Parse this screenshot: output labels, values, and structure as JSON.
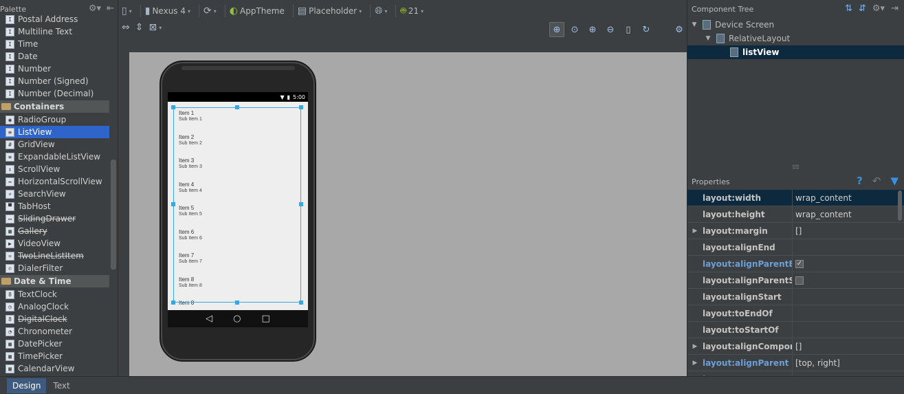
{
  "palette": {
    "title": "Palette",
    "items_top": [
      {
        "label": "Postal Address",
        "icon": "I",
        "strike": false
      },
      {
        "label": "Multiline Text",
        "icon": "I",
        "strike": false
      },
      {
        "label": "Time",
        "icon": "I",
        "strike": false
      },
      {
        "label": "Date",
        "icon": "I",
        "strike": false
      },
      {
        "label": "Number",
        "icon": "I",
        "strike": false
      },
      {
        "label": "Number (Signed)",
        "icon": "I",
        "strike": false
      },
      {
        "label": "Number (Decimal)",
        "icon": "I",
        "strike": false
      }
    ],
    "category_containers": "Containers",
    "containers": [
      {
        "label": "RadioGroup",
        "icon": "◉",
        "strike": false
      },
      {
        "label": "ListView",
        "icon": "≡",
        "strike": false,
        "selected": true
      },
      {
        "label": "GridView",
        "icon": "#",
        "strike": false
      },
      {
        "label": "ExpandableListView",
        "icon": "≡",
        "strike": false
      },
      {
        "label": "ScrollView",
        "icon": "↕",
        "strike": false
      },
      {
        "label": "HorizontalScrollView",
        "icon": "↔",
        "strike": false
      },
      {
        "label": "SearchView",
        "icon": "⌕",
        "strike": false
      },
      {
        "label": "TabHost",
        "icon": "▀",
        "strike": false
      },
      {
        "label": "SlidingDrawer",
        "icon": "▭",
        "strike": true
      },
      {
        "label": "Gallery",
        "icon": "▦",
        "strike": true
      },
      {
        "label": "VideoView",
        "icon": "▶",
        "strike": false
      },
      {
        "label": "TwoLineListItem",
        "icon": "=",
        "strike": true
      },
      {
        "label": "DialerFilter",
        "icon": "✆",
        "strike": false
      }
    ],
    "category_datetime": "Date & Time",
    "datetime": [
      {
        "label": "TextClock",
        "icon": "8",
        "strike": false
      },
      {
        "label": "AnalogClock",
        "icon": "◷",
        "strike": false
      },
      {
        "label": "DigitalClock",
        "icon": "8",
        "strike": true
      },
      {
        "label": "Chronometer",
        "icon": "◔",
        "strike": false
      },
      {
        "label": "DatePicker",
        "icon": "▦",
        "strike": false
      },
      {
        "label": "TimePicker",
        "icon": "▦",
        "strike": false
      },
      {
        "label": "CalendarView",
        "icon": "▦",
        "strike": false
      }
    ]
  },
  "toolbar": {
    "device": "Nexus 4",
    "theme": "AppTheme",
    "activity": "Placeholder",
    "api": "21"
  },
  "device_screen": {
    "time": "5:00",
    "list_items": [
      {
        "title": "Item 1",
        "sub": "Sub Item 1"
      },
      {
        "title": "Item 2",
        "sub": "Sub Item 2"
      },
      {
        "title": "Item 3",
        "sub": "Sub Item 3"
      },
      {
        "title": "Item 4",
        "sub": "Sub Item 4"
      },
      {
        "title": "Item 5",
        "sub": "Sub Item 5"
      },
      {
        "title": "Item 6",
        "sub": "Sub Item 6"
      },
      {
        "title": "Item 7",
        "sub": "Sub Item 7"
      },
      {
        "title": "Item 8",
        "sub": "Sub Item 8"
      },
      {
        "title": "Item 8",
        "sub": ""
      }
    ]
  },
  "component_tree": {
    "title": "Component Tree",
    "nodes": [
      {
        "label": "Device Screen",
        "level": 0
      },
      {
        "label": "RelativeLayout",
        "level": 1
      },
      {
        "label": "listView",
        "level": 2,
        "selected": true
      }
    ]
  },
  "properties": {
    "title": "Properties",
    "rows": [
      {
        "name": "layout:width",
        "value": "wrap_content",
        "expandable": false,
        "blue": false,
        "selected": true
      },
      {
        "name": "layout:height",
        "value": "wrap_content",
        "expandable": false,
        "blue": false
      },
      {
        "name": "layout:margin",
        "value": "[]",
        "expandable": true,
        "blue": false
      },
      {
        "name": "layout:alignEnd",
        "value": "",
        "expandable": false,
        "blue": false
      },
      {
        "name": "layout:alignParentEnd",
        "value": "",
        "checkbox": "checked",
        "expandable": false,
        "blue": true
      },
      {
        "name": "layout:alignParentStart",
        "value": "",
        "checkbox": "unchecked",
        "expandable": false,
        "blue": false
      },
      {
        "name": "layout:alignStart",
        "value": "",
        "expandable": false,
        "blue": false
      },
      {
        "name": "layout:toEndOf",
        "value": "",
        "expandable": false,
        "blue": false
      },
      {
        "name": "layout:toStartOf",
        "value": "",
        "expandable": false,
        "blue": false
      },
      {
        "name": "layout:alignComponent",
        "value": "[]",
        "expandable": true,
        "blue": false
      },
      {
        "name": "layout:alignParent",
        "value": "[top, right]",
        "expandable": true,
        "blue": true
      },
      {
        "name": "layout:centerInParent",
        "value": "",
        "expandable": false,
        "blue": false
      }
    ]
  },
  "bottom_tabs": [
    {
      "label": "Design",
      "active": true
    },
    {
      "label": "Text",
      "active": false
    }
  ]
}
